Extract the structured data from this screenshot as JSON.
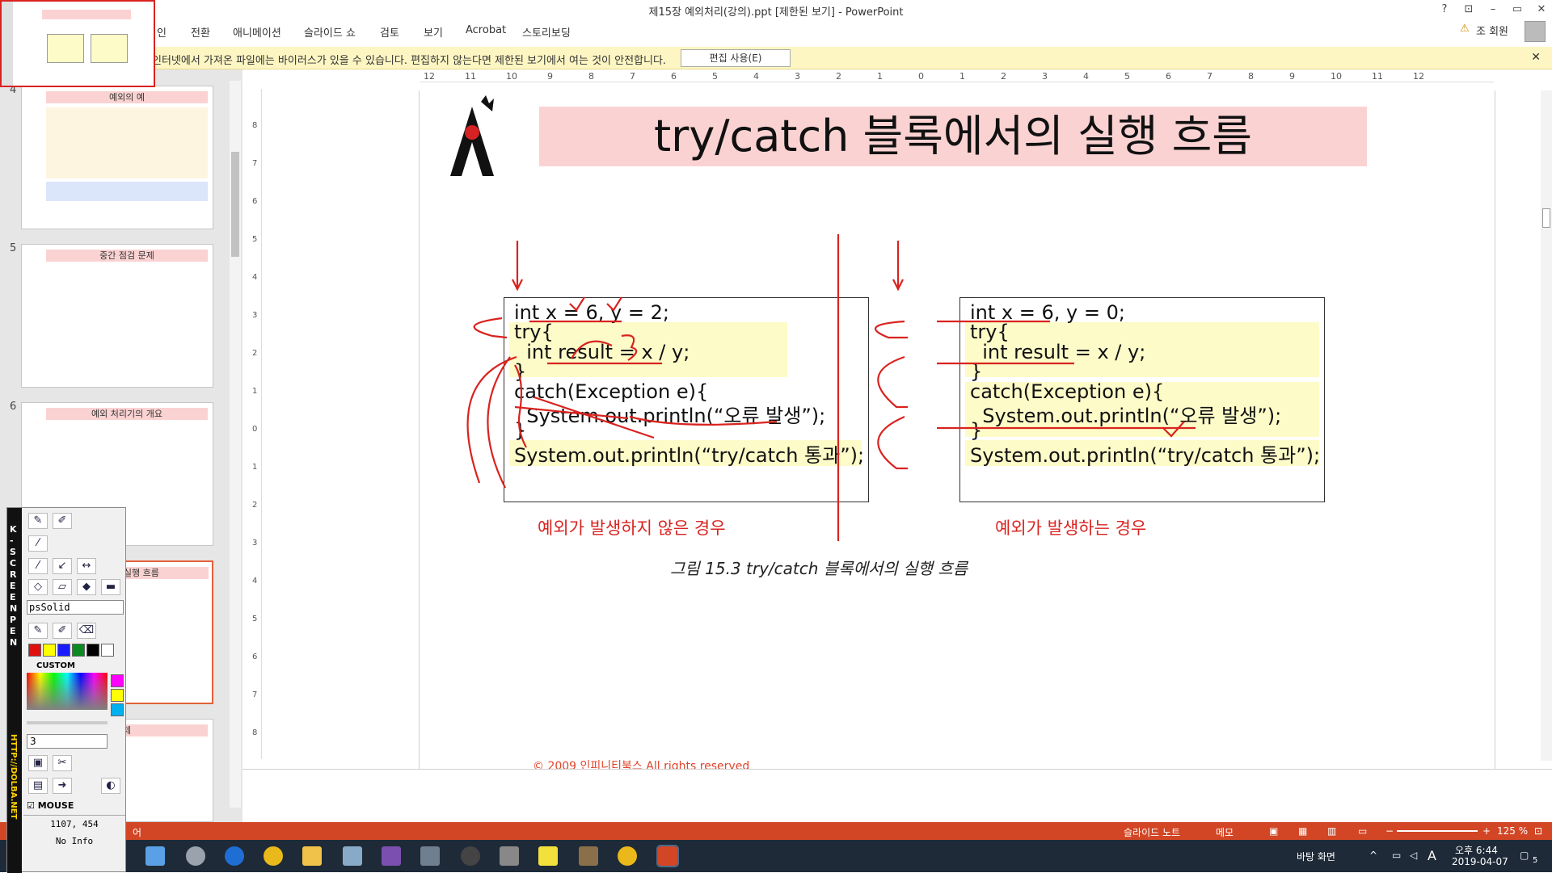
{
  "window": {
    "title": "제15장 예외처리(강의).ppt [제한된 보기] - PowerPoint",
    "controls": [
      "?",
      "⊡",
      "–",
      "▭",
      "✕"
    ]
  },
  "ribbon": {
    "tabs": [
      "인",
      "전환",
      "애니메이션",
      "슬라이드 쇼",
      "검토",
      "보기",
      "Acrobat",
      "스토리보딩"
    ],
    "user": "조 회원"
  },
  "protected_view": {
    "message": "인터넷에서 가져온 파일에는 바이러스가 있을 수 있습니다. 편집하지 않는다면 제한된 보기에서 여는 것이 안전합니다.",
    "button": "편집 사용(E)",
    "close": "✕"
  },
  "ruler": {
    "horizontal": [
      "12",
      "11",
      "10",
      "9",
      "8",
      "7",
      "6",
      "5",
      "4",
      "3",
      "2",
      "1",
      "0",
      "1",
      "2",
      "3",
      "4",
      "5",
      "6",
      "7",
      "8",
      "9",
      "10",
      "11",
      "12"
    ],
    "vertical": [
      "8",
      "7",
      "6",
      "5",
      "4",
      "3",
      "2",
      "1",
      "0",
      "1",
      "2",
      "3",
      "4",
      "5",
      "6",
      "7",
      "8"
    ]
  },
  "thumbnails": [
    {
      "num": "4",
      "title": "예외의 예"
    },
    {
      "num": "5",
      "title": "중간 점검 문제"
    },
    {
      "num": "6",
      "title": "예외 처리기의 개요"
    },
    {
      "num": "",
      "title": "에서의 실행 흐름"
    },
    {
      "num": "",
      "title": "제"
    }
  ],
  "slide": {
    "title": "try/catch 블록에서의 실행 흐름",
    "left_box": [
      "int x = 6, y = 2;",
      "try{",
      "  int result = x / y;",
      "}",
      "catch(Exception e){",
      "  System.out.println(“오류 발생”);",
      "}",
      "System.out.println(“try/catch 통과”);"
    ],
    "right_box": [
      "int x = 6, y = 0;",
      "try{",
      "  int result = x / y;",
      "}",
      "catch(Exception e){",
      "  System.out.println(“오류 발생”);",
      "}",
      "System.out.println(“try/catch 통과”);"
    ],
    "left_label": "예외가 발생하지 않은 경우",
    "right_label": "예외가 발생하는 경우",
    "caption": "그림 15.3 try/catch 블록에서의 실행 흐름",
    "copyright": "© 2009 인피니티북스 All rights reserved"
  },
  "statusbar": {
    "left": "어",
    "notes": "슬라이드 노트",
    "memo": "메모",
    "zoom": "125 %"
  },
  "taskbar": {
    "desktop": "바탕 화면",
    "time": "오후 6:44",
    "date": "2019-04-07",
    "ime": "A",
    "notif_count": "5"
  },
  "screen_pen": {
    "vertical_title": "K-SCREEN PEN",
    "url": "HTTP://DOLBA.NET",
    "line_style": "psSolid",
    "custom_label": "CUSTOM",
    "width_value": "3",
    "mouse_label": "MOUSE",
    "coords": "1107, 454",
    "info": "No Info",
    "colors": [
      "#e01010",
      "#ffff00",
      "#1a1aff",
      "#0a8a20",
      "#000000",
      "#ffffff"
    ],
    "custom_colors": [
      "#ff00ff",
      "#ffff00",
      "#00b0f0"
    ]
  }
}
